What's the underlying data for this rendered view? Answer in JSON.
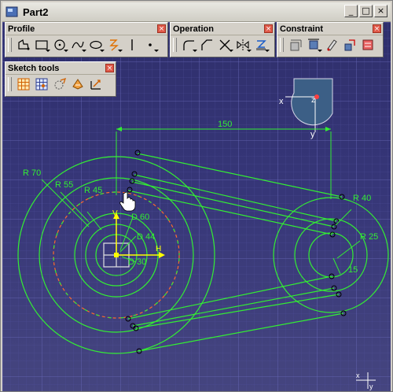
{
  "window": {
    "title": "Part2",
    "buttons": [
      "minimize",
      "maximize",
      "close"
    ]
  },
  "toolbars": {
    "profile": {
      "title": "Profile",
      "tools": [
        "profile-icon",
        "rectangle-icon",
        "circle-icon",
        "spline-icon",
        "ellipse-icon",
        "axis-icon",
        "line-icon",
        "point-icon"
      ]
    },
    "operation": {
      "title": "Operation",
      "tools": [
        "corner-icon",
        "chamfer-icon",
        "trim-icon",
        "mirror-icon",
        "project-icon"
      ]
    },
    "constraint": {
      "title": "Constraint",
      "tools": [
        "constraint-icon",
        "fix-icon",
        "auto-constraint-icon",
        "animate-constraint-icon",
        "edit-constraint-icon"
      ]
    },
    "sketch_tools": {
      "title": "Sketch tools",
      "tools": [
        "grid-icon",
        "snap-to-point-icon",
        "construction-elements-icon",
        "geometric-constraints-icon",
        "dimensional-constraints-icon"
      ]
    }
  },
  "sketch": {
    "dimension_150": "150",
    "radius_labels": {
      "r70": "R 70",
      "r55": "R 55",
      "r45": "R 45",
      "r40": "R 40",
      "r25": "R 25",
      "r15": "15"
    },
    "diameter_labels": {
      "d60": "D 60",
      "d44": "D 44",
      "d30": "D 30"
    },
    "axis_labels": {
      "h": "H",
      "v": "V"
    },
    "compass_labels": {
      "x": "x",
      "y": "y",
      "z": "z"
    },
    "corner_axis_labels": {
      "x": "x",
      "y": "y"
    }
  },
  "colors": {
    "geometry": "#33ee33",
    "construction": "#ff6a2a",
    "axis": "#ffff00",
    "background": "#363678"
  }
}
